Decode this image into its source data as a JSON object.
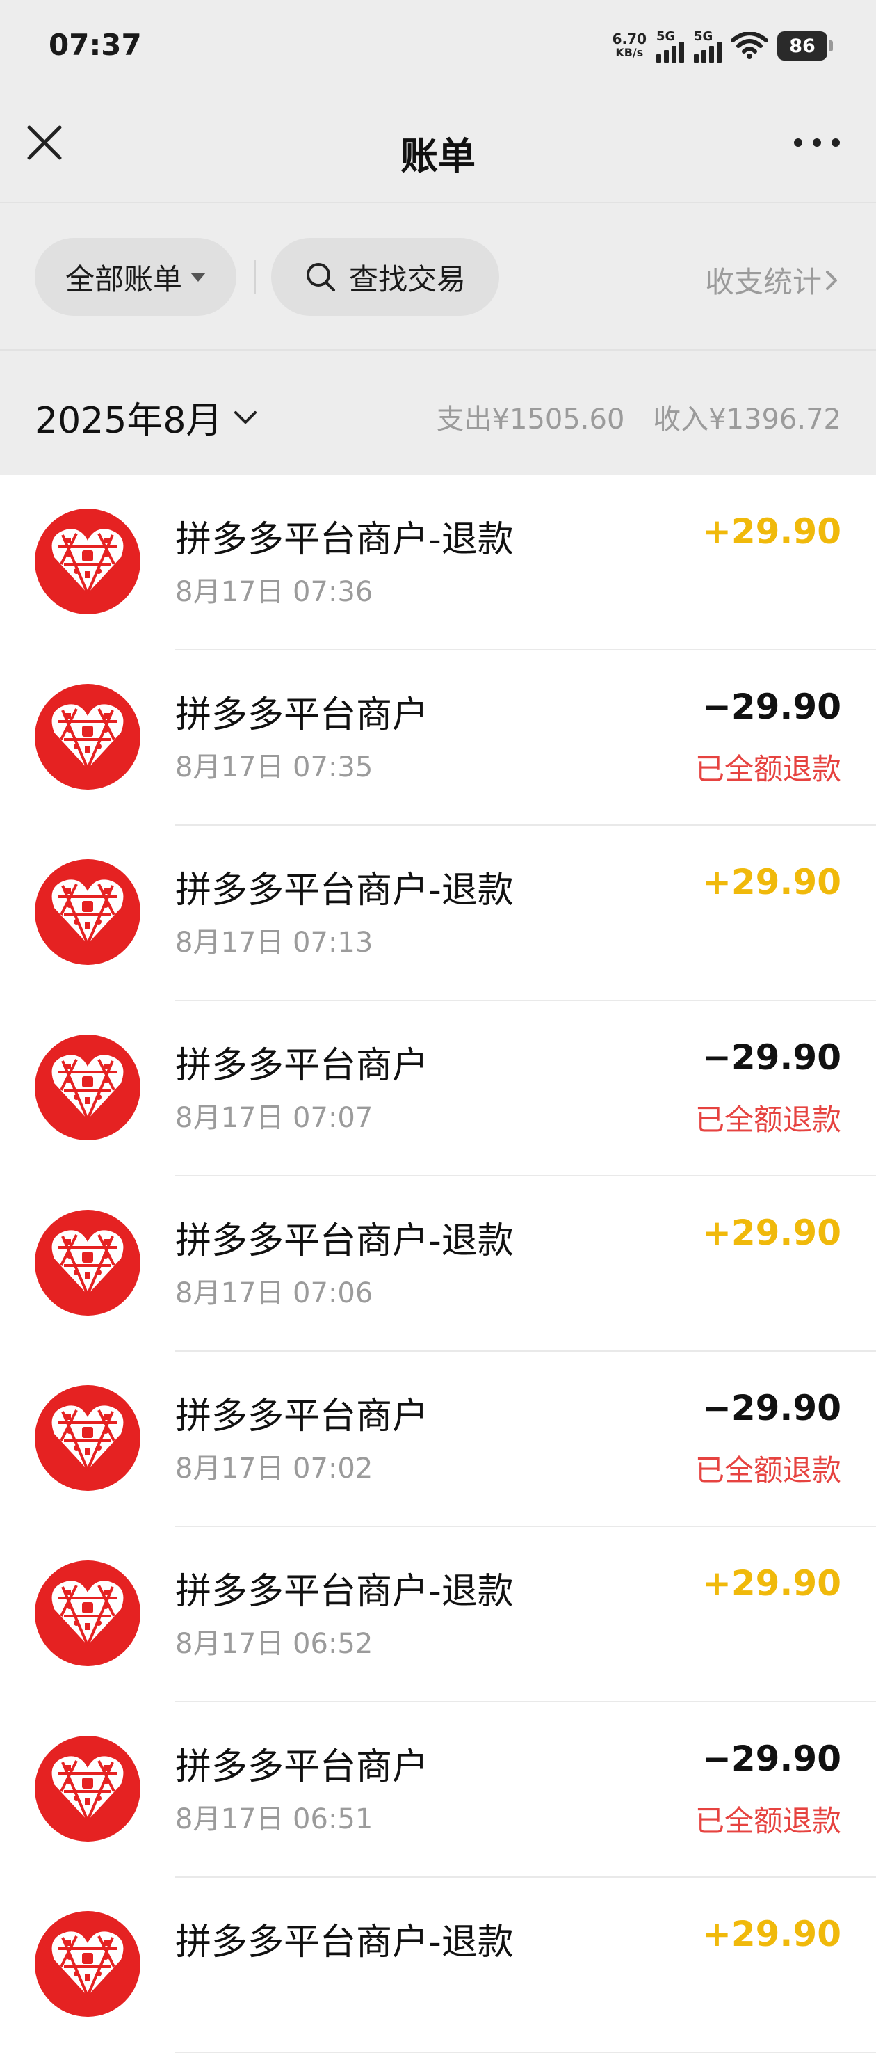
{
  "status": {
    "time": "07:37",
    "speed_value": "6.70",
    "speed_unit": "KB/s",
    "sim1": "5G",
    "sim2": "5G",
    "battery": "86"
  },
  "nav": {
    "title": "账单",
    "close_icon": "close-icon",
    "more_icon": "more-icon"
  },
  "filter": {
    "all_bills": "全部账单",
    "search": "查找交易",
    "stats": "收支统计"
  },
  "month": {
    "label": "2025年8月",
    "expense": "支出¥1505.60",
    "income": "收入¥1396.72"
  },
  "colors": {
    "brand_red": "#e52222",
    "income_yellow": "#f0b90b",
    "refund_red": "#e64340"
  },
  "transactions": [
    {
      "merchant": "拼多多平台商户-退款",
      "time": "8月17日 07:36",
      "amount": "+29.90",
      "refund": ""
    },
    {
      "merchant": "拼多多平台商户",
      "time": "8月17日 07:35",
      "amount": "−29.90",
      "refund": "已全额退款"
    },
    {
      "merchant": "拼多多平台商户-退款",
      "time": "8月17日 07:13",
      "amount": "+29.90",
      "refund": ""
    },
    {
      "merchant": "拼多多平台商户",
      "time": "8月17日 07:07",
      "amount": "−29.90",
      "refund": "已全额退款"
    },
    {
      "merchant": "拼多多平台商户-退款",
      "time": "8月17日 07:06",
      "amount": "+29.90",
      "refund": ""
    },
    {
      "merchant": "拼多多平台商户",
      "time": "8月17日 07:02",
      "amount": "−29.90",
      "refund": "已全额退款"
    },
    {
      "merchant": "拼多多平台商户-退款",
      "time": "8月17日 06:52",
      "amount": "+29.90",
      "refund": ""
    },
    {
      "merchant": "拼多多平台商户",
      "time": "8月17日 06:51",
      "amount": "−29.90",
      "refund": "已全额退款"
    },
    {
      "merchant": "拼多多平台商户-退款",
      "time": "",
      "amount": "+29.90",
      "refund": ""
    }
  ]
}
